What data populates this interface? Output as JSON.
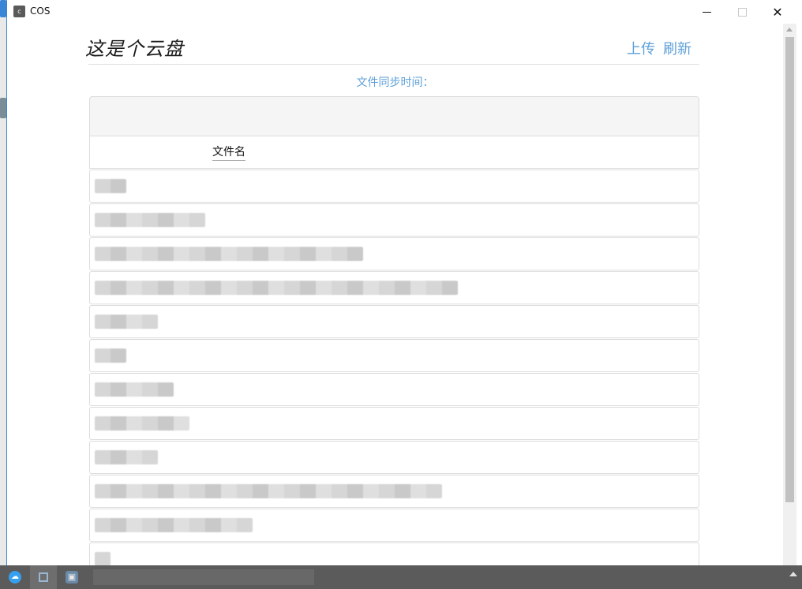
{
  "window": {
    "title": "COS",
    "app_icon_letter": "c"
  },
  "header": {
    "brand": "这是个云盘",
    "upload_label": "上传",
    "refresh_label": "刷新"
  },
  "sync": {
    "label": "文件同步时间："
  },
  "table": {
    "column_filename": "文件名",
    "rows": [
      {
        "name": "",
        "redacted_width": 40
      },
      {
        "name": "",
        "redacted_width": 140
      },
      {
        "name": "",
        "redacted_width": 340
      },
      {
        "name": "",
        "redacted_width": 460
      },
      {
        "name": "",
        "redacted_width": 80
      },
      {
        "name": "",
        "redacted_width": 40
      },
      {
        "name": "",
        "redacted_width": 100
      },
      {
        "name": "",
        "redacted_width": 120
      },
      {
        "name": "",
        "redacted_width": 80
      },
      {
        "name": "",
        "redacted_width": 440
      },
      {
        "name": "",
        "redacted_width": 200
      },
      {
        "name": "",
        "redacted_width": 20
      }
    ]
  },
  "taskbar": {
    "items": [
      "app-cloud",
      "app-window",
      "app-vm"
    ]
  }
}
